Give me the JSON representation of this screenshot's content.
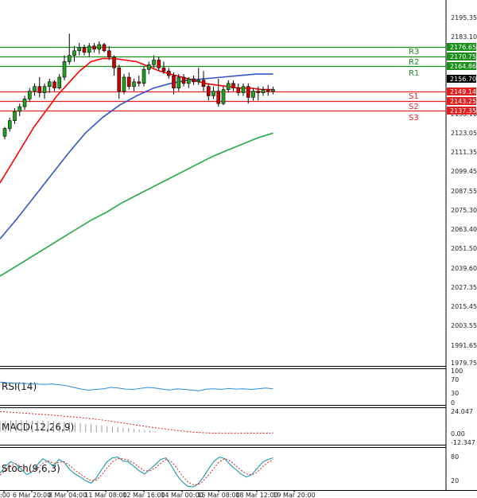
{
  "chart_data": {
    "type": "candlestick",
    "price_axis": {
      "ylim": [
        1979.75,
        2207.0
      ],
      "ticks": [
        "2195.35",
        "2183.10",
        "2171.10",
        "2159.10",
        "2147.10",
        "2135.10",
        "2123.05",
        "2111.35",
        "2099.45",
        "2087.55",
        "2075.30",
        "2063.40",
        "2051.50",
        "2039.60",
        "2027.35",
        "2015.45",
        "2003.55",
        "1991.65",
        "1979.75"
      ]
    },
    "x_axis": {
      "labels": [
        ":00",
        "6 Mar 20:00",
        "8 Mar 04:00",
        "11 Mar 08:00",
        "12 Mar 16:00",
        "14 Mar 00:00",
        "15 Mar 08:00",
        "18 Mar 12:00",
        "19 Mar 20:00"
      ],
      "positions": [
        5,
        40,
        85,
        133,
        181,
        229,
        275,
        323,
        370
      ]
    },
    "current_price": "2156.70",
    "levels": {
      "resistance": [
        {
          "name": "R3",
          "value": 2176.65,
          "label": "2176.65"
        },
        {
          "name": "R2",
          "value": 2170.75,
          "label": "2170.75"
        },
        {
          "name": "R1",
          "value": 2164.86,
          "label": "2164.86"
        }
      ],
      "support": [
        {
          "name": "S1",
          "value": 2149.14,
          "label": "2149.14"
        },
        {
          "name": "S2",
          "value": 2143.25,
          "label": "2143.25"
        },
        {
          "name": "S3",
          "value": 2137.35,
          "label": "2137.35"
        }
      ]
    },
    "candles": [
      [
        2126,
        2132,
        2124,
        2131
      ],
      [
        2131,
        2138,
        2129,
        2136
      ],
      [
        2136,
        2144,
        2134,
        2142
      ],
      [
        2142,
        2147,
        2139,
        2145
      ],
      [
        2145,
        2152,
        2143,
        2150
      ],
      [
        2150,
        2157,
        2148,
        2155
      ],
      [
        2155,
        2160,
        2152,
        2158
      ],
      [
        2158,
        2164,
        2151,
        2154
      ],
      [
        2154,
        2160,
        2150,
        2158
      ],
      [
        2158,
        2163,
        2154,
        2161
      ],
      [
        2161,
        2162,
        2155,
        2157
      ],
      [
        2157,
        2166,
        2156,
        2164
      ],
      [
        2164,
        2178,
        2162,
        2174
      ],
      [
        2174,
        2192,
        2172,
        2178
      ],
      [
        2178,
        2184,
        2174,
        2181
      ],
      [
        2181,
        2186,
        2178,
        2183
      ],
      [
        2183,
        2185,
        2178,
        2180
      ],
      [
        2180,
        2186,
        2177,
        2184
      ],
      [
        2184,
        2186,
        2180,
        2182
      ],
      [
        2182,
        2187,
        2179,
        2185
      ],
      [
        2185,
        2186,
        2180,
        2181
      ],
      [
        2181,
        2184,
        2175,
        2177
      ],
      [
        2177,
        2178,
        2165,
        2170
      ],
      [
        2170,
        2172,
        2150,
        2155
      ],
      [
        2155,
        2166,
        2153,
        2164
      ],
      [
        2164,
        2167,
        2156,
        2158
      ],
      [
        2158,
        2163,
        2155,
        2161
      ],
      [
        2161,
        2165,
        2158,
        2160
      ],
      [
        2160,
        2171,
        2158,
        2169
      ],
      [
        2169,
        2174,
        2166,
        2172
      ],
      [
        2172,
        2178,
        2170,
        2175
      ],
      [
        2175,
        2177,
        2168,
        2170
      ],
      [
        2170,
        2174,
        2166,
        2168
      ],
      [
        2168,
        2170,
        2163,
        2165
      ],
      [
        2165,
        2167,
        2153,
        2157
      ],
      [
        2157,
        2166,
        2155,
        2164
      ],
      [
        2164,
        2166,
        2158,
        2160
      ],
      [
        2160,
        2164,
        2157,
        2163
      ],
      [
        2163,
        2165,
        2159,
        2161
      ],
      [
        2161,
        2170,
        2159,
        2162
      ],
      [
        2162,
        2168,
        2155,
        2158
      ],
      [
        2158,
        2160,
        2149,
        2152
      ],
      [
        2152,
        2158,
        2150,
        2155
      ],
      [
        2155,
        2163,
        2145,
        2147
      ],
      [
        2147,
        2158,
        2146,
        2156
      ],
      [
        2156,
        2162,
        2154,
        2160
      ],
      [
        2160,
        2162,
        2155,
        2157
      ],
      [
        2157,
        2160,
        2152,
        2154
      ],
      [
        2154,
        2160,
        2152,
        2158
      ],
      [
        2158,
        2160,
        2147,
        2151
      ],
      [
        2151,
        2157,
        2149,
        2155
      ],
      [
        2155,
        2158,
        2149,
        2154
      ],
      [
        2154,
        2158,
        2152,
        2156
      ],
      [
        2156,
        2159,
        2152,
        2155
      ],
      [
        2155,
        2158,
        2153,
        2156
      ]
    ],
    "moving_averages": [
      {
        "color": "#ff0000",
        "values": [
          2096,
          2108,
          2120,
          2132,
          2142,
          2152,
          2160,
          2168,
          2174,
          2176,
          2176,
          2175,
          2174,
          2171,
          2168,
          2166,
          2164,
          2162,
          2160,
          2159,
          2158,
          2157,
          2157,
          2156,
          2156
        ]
      },
      {
        "color": "#3355cc",
        "values": [
          2060,
          2073,
          2087,
          2101,
          2115,
          2128,
          2138,
          2146,
          2152,
          2157,
          2160,
          2162,
          2163,
          2164,
          2165,
          2166,
          2166
        ]
      },
      {
        "color": "#22aa44",
        "values": [
          2036,
          2042,
          2048,
          2054,
          2060,
          2066,
          2072,
          2077,
          2083,
          2088,
          2093,
          2098,
          2103,
          2108,
          2113,
          2117,
          2121,
          2125,
          2128
        ]
      }
    ],
    "indicators": {
      "rsi": {
        "label": "RSI(14)",
        "ticks": [
          "100",
          "70",
          "30",
          "0"
        ],
        "ylim": [
          0,
          100
        ],
        "values": [
          66,
          64,
          63,
          62,
          61,
          60,
          59,
          60,
          58,
          55,
          50,
          45,
          42,
          44,
          46,
          50,
          48,
          45,
          44,
          47,
          50,
          48,
          45,
          42,
          46,
          44,
          42,
          40,
          45,
          46,
          44,
          47,
          45,
          46,
          44,
          46,
          48,
          46
        ]
      },
      "macd": {
        "label": "MACD(12,26,9)",
        "ticks": [
          "24.047",
          "0.00",
          "-12.347"
        ],
        "ylim": [
          -12.347,
          24.047
        ],
        "histogram": [
          12,
          12.4,
          12.8,
          13,
          13,
          12.8,
          12.6,
          12.4,
          12.2,
          12,
          11.8,
          11.4,
          11,
          10.6,
          10.1,
          9.6,
          9,
          8.4,
          7.8,
          7.2,
          6.6,
          6,
          5.4,
          4.8,
          4.2,
          3.6,
          3,
          2.4,
          1.8,
          1.2,
          0.6,
          0.2,
          0,
          -0.2,
          -0.4,
          -0.6,
          -0.7,
          -0.8,
          -0.9,
          -1.0,
          -1.0,
          -1.1,
          -1.2,
          -1.1,
          -1.0,
          -1.0,
          -1.0,
          -0.9,
          -0.9,
          -0.8,
          -0.8,
          -0.8
        ],
        "signal": [
          22,
          21.4,
          20.8,
          20.2,
          19.6,
          19,
          18.2,
          17.4,
          16.6,
          15.8,
          14.8,
          13.8,
          12.6,
          11.2,
          9.8,
          8.4,
          7.0,
          5.6,
          4.4,
          3.2,
          2.0,
          1.0,
          0.2,
          -0.4,
          -0.8,
          -1.0,
          -1.1,
          -1.1,
          -1.0,
          -0.9,
          -0.9,
          -0.8
        ]
      },
      "stoch": {
        "label": "Stoch(9,6,3)",
        "ticks": [
          "80",
          "20"
        ],
        "ylim": [
          0,
          100
        ],
        "main": [
          40,
          58,
          70,
          64,
          50,
          36,
          44,
          62,
          78,
          70,
          58,
          76,
          68,
          50,
          38,
          30,
          20,
          14,
          28,
          50,
          70,
          80,
          82,
          72,
          70,
          58,
          46,
          38,
          50,
          62,
          76,
          80,
          60,
          36,
          18,
          6,
          4,
          12,
          30,
          52,
          72,
          82,
          78,
          62,
          50,
          38,
          30,
          36,
          52,
          68,
          76,
          80
        ],
        "signal": [
          35,
          48,
          60,
          64,
          58,
          48,
          44,
          52,
          66,
          72,
          66,
          68,
          70,
          60,
          48,
          38,
          28,
          20,
          22,
          36,
          54,
          70,
          78,
          78,
          74,
          66,
          56,
          46,
          46,
          54,
          66,
          76,
          70,
          54,
          34,
          18,
          10,
          10,
          20,
          36,
          54,
          70,
          78,
          72,
          60,
          48,
          38,
          36,
          42,
          56,
          68,
          76
        ]
      }
    }
  }
}
